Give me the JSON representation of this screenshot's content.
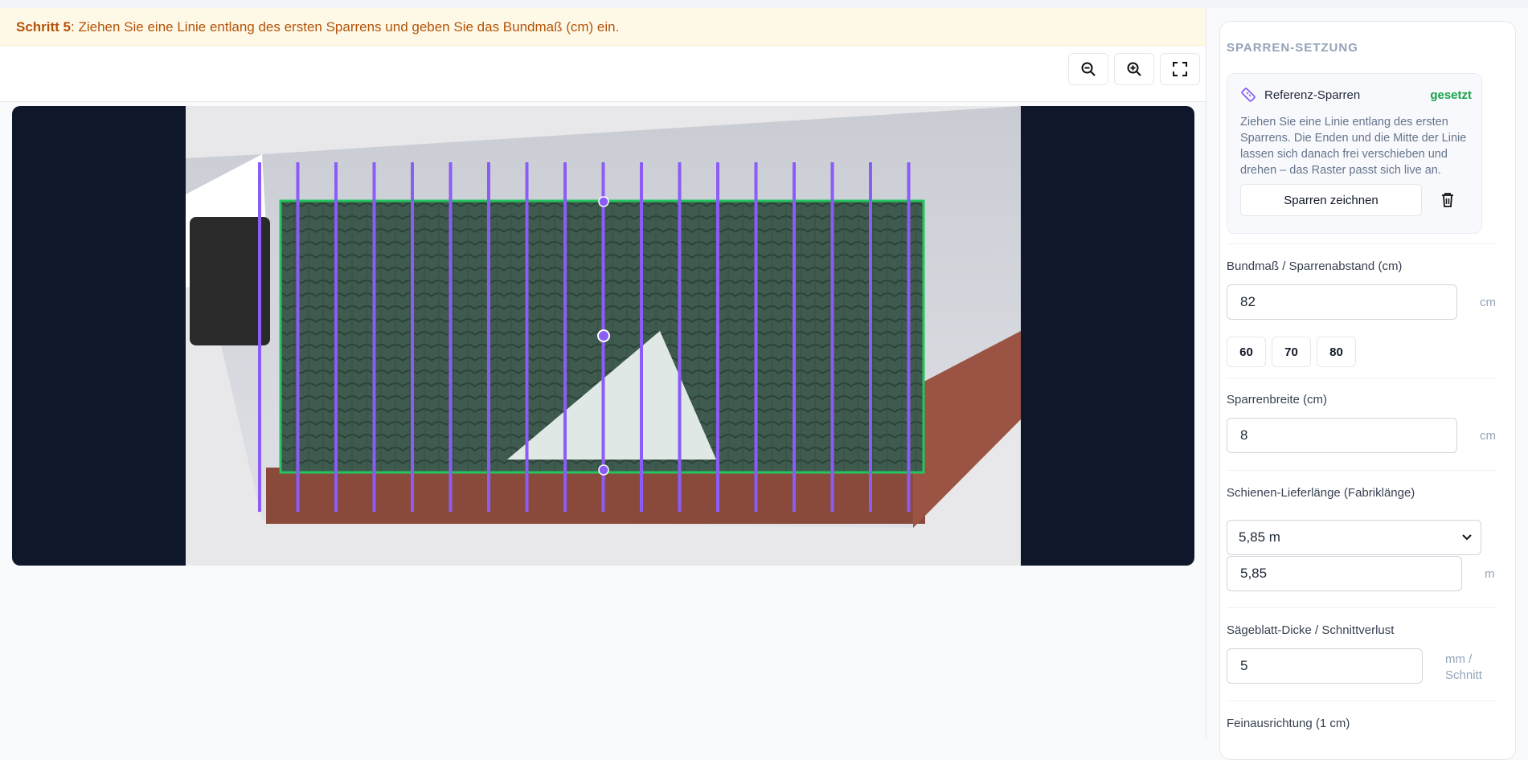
{
  "banner": {
    "step_label": "Schritt 5",
    "instruction": ": Ziehen Sie eine Linie entlang des ersten Sparrens und geben Sie das Bundmaß (cm) ein."
  },
  "toolbar": {
    "zoom_out": "zoom-out-icon",
    "zoom_in": "zoom-in-icon",
    "fullscreen": "fullscreen-icon"
  },
  "colors": {
    "rafter": "#8b5cf6",
    "roof_outline": "#22c55e",
    "banner_text": "#b45309",
    "status_ok": "#16a34a",
    "canvas_bg": "#0f172a"
  },
  "sidebar": {
    "title": "SPARREN-SETZUNG",
    "reference": {
      "title": "Referenz-Sparren",
      "status": "gesetzt",
      "description": "Ziehen Sie eine Linie entlang des ersten Sparrens. Die Enden und die Mitte der Linie lassen sich danach frei verschieben und drehen – das Raster passt sich live an.",
      "draw_button": "Sparren zeichnen",
      "delete_icon": "trash-icon"
    },
    "spacing": {
      "label": "Bundmaß / Sparrenabstand (cm)",
      "value": "82",
      "unit": "cm",
      "presets": [
        "60",
        "70",
        "80"
      ]
    },
    "width": {
      "label": "Sparrenbreite (cm)",
      "value": "8",
      "unit": "cm"
    },
    "rail": {
      "label": "Schienen-Lieferlänge (Fabriklänge)",
      "selected": "5,85 m",
      "value": "5,85",
      "unit": "m"
    },
    "saw": {
      "label": "Sägeblatt-Dicke / Schnittverlust",
      "value": "5",
      "unit_line1": "mm /",
      "unit_line2": "Schnitt"
    },
    "fine": {
      "label": "Feinausrichtung (1 cm)"
    }
  }
}
